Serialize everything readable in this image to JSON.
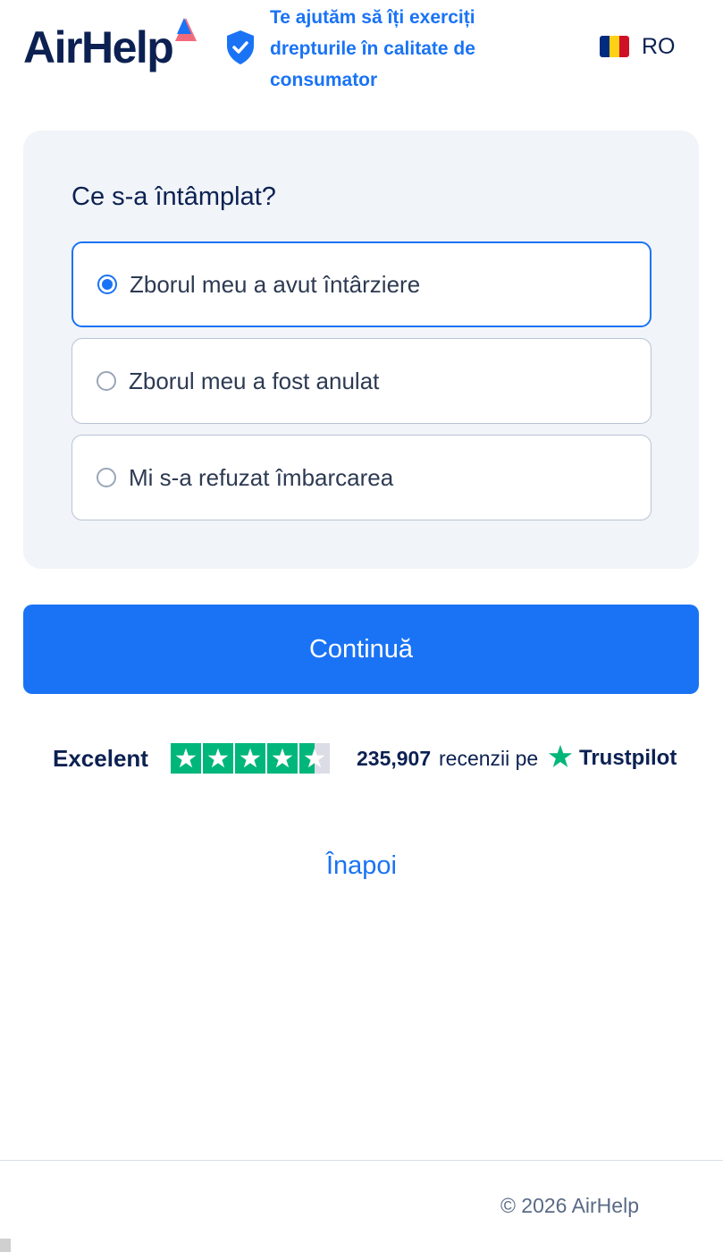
{
  "header": {
    "logo_text": "AirHelp",
    "tagline": "Te ajutăm să îți exerciți drepturile în calitate de consumator",
    "language_code": "RO",
    "flag_colors": [
      "#002B7F",
      "#FCD116",
      "#CE1126"
    ]
  },
  "question": {
    "title": "Ce s-a întâmplat?",
    "options": [
      {
        "label": "Zborul meu a avut întârziere",
        "selected": true
      },
      {
        "label": "Zborul meu a fost anulat",
        "selected": false
      },
      {
        "label": "Mi s-a refuzat îmbarcarea",
        "selected": false
      }
    ]
  },
  "continue_label": "Continuă",
  "trustpilot": {
    "rating_label": "Excelent",
    "stars": 4.5,
    "review_count": "235,907",
    "reviews_text": "recenzii pe",
    "brand": "Trustpilot"
  },
  "back_label": "Înapoi",
  "footer": {
    "copyright": "© 2026 AirHelp"
  },
  "colors": {
    "accent": "#1a73f5",
    "navy": "#0c2152",
    "trust_green": "#00b67a",
    "logo_red": "#f26b7a"
  },
  "icons": [
    "shield-check-icon",
    "star-icon",
    "radio-selected-icon",
    "radio-unselected-icon"
  ]
}
